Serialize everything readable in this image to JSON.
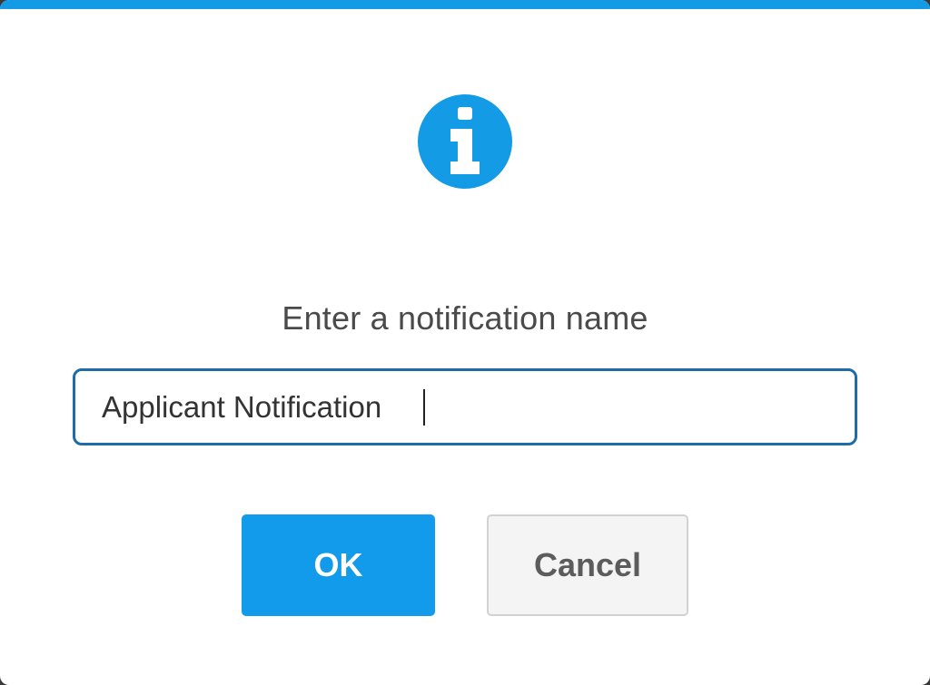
{
  "dialog": {
    "accent_color": "#139be6",
    "icon": "info-circle-icon",
    "prompt": "Enter a notification name",
    "input": {
      "value": "Applicant Notification",
      "focused": true
    },
    "buttons": {
      "ok_label": "OK",
      "cancel_label": "Cancel"
    }
  }
}
